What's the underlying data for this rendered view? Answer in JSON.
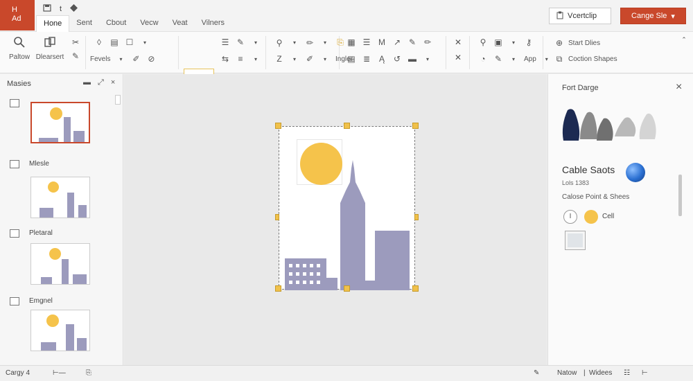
{
  "app": {
    "badge_line1": "H",
    "badge_line2": "Ad"
  },
  "quick_access": {
    "save_icon": "save-icon",
    "divider": "t",
    "pin_icon": "diamond-icon"
  },
  "tabs": [
    {
      "label": "Hone",
      "active": true
    },
    {
      "label": "Sent"
    },
    {
      "label": "Cbout"
    },
    {
      "label": "Vecw"
    },
    {
      "label": "Veat"
    },
    {
      "label": "Vilners"
    }
  ],
  "top_buttons": {
    "vertclip": "Vcertclip",
    "change": "Cange Sle",
    "change_caret": "▾"
  },
  "ribbon": {
    "paste_label": "Paltow",
    "clearsert_label": "Dlearsert",
    "fevels_label": "Fevels",
    "ingler_label": "Ingler",
    "app_label": "App",
    "start_label": "Start Dlies",
    "caption_label": "Coction Shapes"
  },
  "left_pane": {
    "title": "Masies",
    "tools": [
      "▬",
      "⤢",
      "×"
    ],
    "slides": [
      {
        "label": "",
        "selected": true
      },
      {
        "label": "Mlesle",
        "selected": false
      },
      {
        "label": "Pletaral",
        "selected": false
      },
      {
        "label": "Emgnel",
        "selected": false
      }
    ]
  },
  "right_pane": {
    "title": "Fort Darge",
    "close": "×",
    "heading": "Cable Saots",
    "subheading": "Lols 1383",
    "section": "Calose Point & Shees",
    "radio_label": "I",
    "cell_label": "Cell",
    "shape_colors": [
      "#1c2a52",
      "#8a8a8a",
      "#707070",
      "#b9b9b9",
      "#d4d4d4"
    ]
  },
  "status": {
    "left": "Cargy 4",
    "right_notes": "Natow",
    "right_sep": "|",
    "right_widees": "Widees"
  },
  "colors": {
    "accent": "#c9482b",
    "sun": "#f5c34b",
    "buildings": "#9c9bbd",
    "handle": "#f0c14b"
  }
}
